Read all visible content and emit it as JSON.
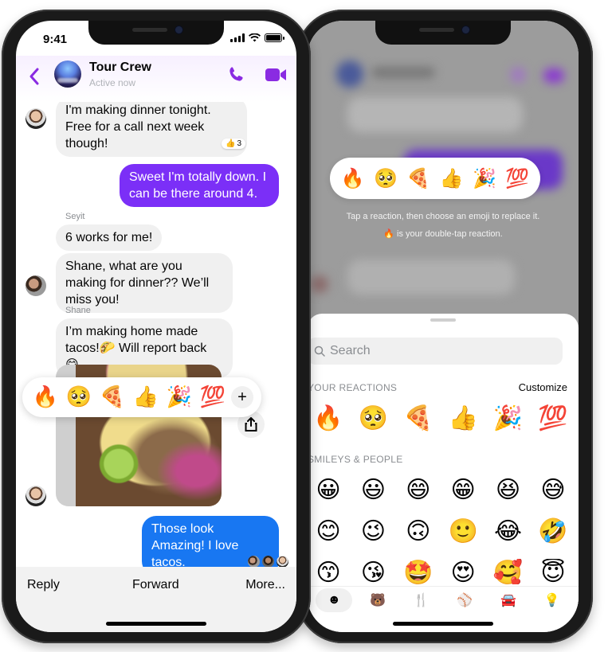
{
  "left_phone": {
    "status_bar": {
      "time": "9:41"
    },
    "header": {
      "title": "Tour Crew",
      "subtitle": "Active now",
      "icons": [
        "back-icon",
        "phone-icon",
        "video-icon"
      ],
      "accent_color": "#8a2be2"
    },
    "messages": [
      {
        "id": "m1",
        "direction": "incoming",
        "text": "I'm making dinner tonight. Free for a call next week though!",
        "reaction": {
          "emoji": "👍",
          "count": "3"
        }
      },
      {
        "id": "m2",
        "direction": "outgoing",
        "text": "Sweet I'm totally down. I can be there around 4.",
        "color": "#7b2ff7"
      },
      {
        "id": "m3",
        "direction": "incoming",
        "sender": "Seyit",
        "text": "6 works for me!"
      },
      {
        "id": "m4",
        "direction": "incoming",
        "text": "Shane, what are you making for dinner?? We’ll miss you!"
      },
      {
        "id": "m5",
        "direction": "incoming",
        "sender": "Shane",
        "text": "I’m making home made tacos!🌮 Will report back 😋"
      },
      {
        "id": "m6",
        "direction": "incoming",
        "type": "photo",
        "alt": "Tacos photo"
      },
      {
        "id": "m7",
        "direction": "outgoing",
        "text": "Those look Amazing! I love tacos.",
        "color": "#1877f2"
      }
    ],
    "reaction_bar": {
      "emojis": [
        "🔥",
        "🥺",
        "🍕",
        "👍",
        "🎉",
        "💯"
      ],
      "more_label": "+"
    },
    "actions": {
      "reply": "Reply",
      "forward": "Forward",
      "more": "More..."
    }
  },
  "right_phone": {
    "reaction_picker": {
      "emojis": [
        "🔥",
        "🥺",
        "🍕",
        "👍",
        "🎉",
        "💯"
      ]
    },
    "hint_line1": "Tap a reaction, then choose an emoji to replace it.",
    "hint_line2_emoji": "🔥",
    "hint_line2": " is your double-tap reaction.",
    "sheet": {
      "search_placeholder": "Search",
      "your_reactions_label": "YOUR REACTIONS",
      "customize_label": "Customize",
      "your_reactions": [
        "🔥",
        "🥺",
        "🍕",
        "👍",
        "🎉",
        "💯"
      ],
      "smileys_label": "SMILEYS & PEOPLE",
      "smileys_rows": [
        [
          "😀",
          "😃",
          "😄",
          "😁",
          "😆",
          "😅"
        ],
        [
          "😊",
          "😉",
          "🙃",
          "🙂",
          "😂",
          "🤣"
        ],
        [
          "😙",
          "😘",
          "🤩",
          "😍",
          "🥰",
          "😇"
        ]
      ],
      "categories": [
        {
          "name": "smileys",
          "icon": "☻",
          "active": true
        },
        {
          "name": "animals",
          "icon": "🐻",
          "active": false
        },
        {
          "name": "food",
          "icon": "🍴",
          "active": false
        },
        {
          "name": "activity",
          "icon": "⚾",
          "active": false
        },
        {
          "name": "travel",
          "icon": "🚘",
          "active": false
        },
        {
          "name": "objects",
          "icon": "💡",
          "active": false
        }
      ]
    }
  }
}
